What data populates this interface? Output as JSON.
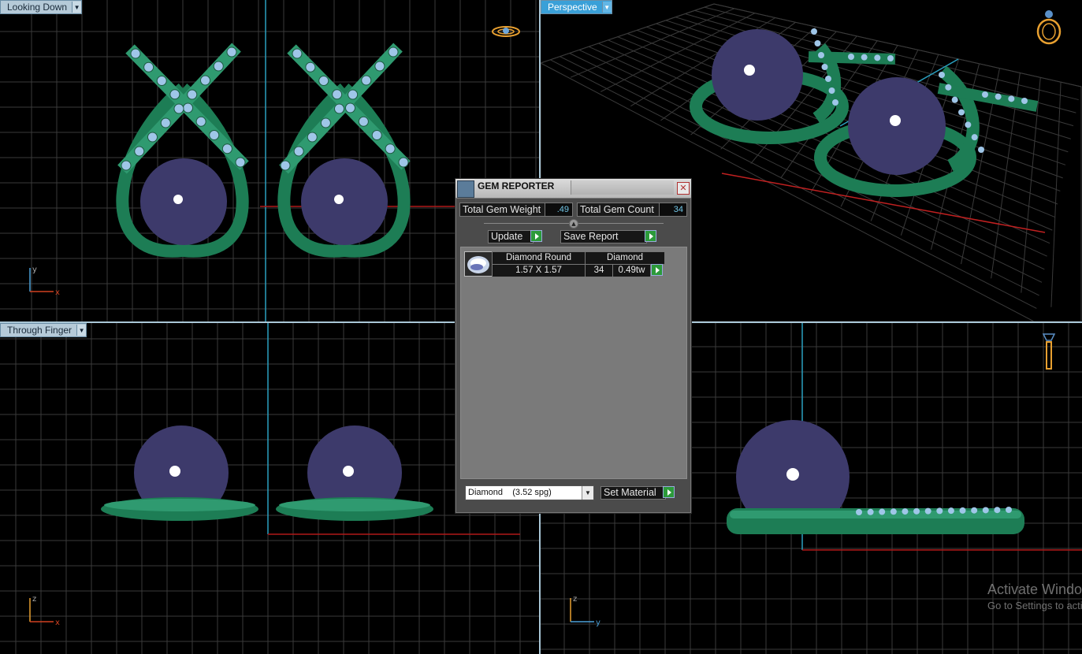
{
  "viewports": {
    "top_left": {
      "label": "Looking Down"
    },
    "top_right": {
      "label": "Perspective"
    },
    "bottom_left": {
      "label": "Through Finger"
    },
    "bottom_right": {
      "label": ""
    }
  },
  "axes": {
    "top_left": {
      "vertical": "y",
      "horizontal": "x"
    },
    "bottom_left": {
      "vertical": "z",
      "horizontal": "x"
    },
    "bottom_right": {
      "vertical": "z",
      "horizontal": "y"
    }
  },
  "colors": {
    "background": "#000000",
    "grid": "#3a3a3a",
    "axis_blue": "#2aa0c0",
    "axis_red": "#c02020",
    "metal_green": "#1d7d55",
    "pearl": "#3d3a6b",
    "gem": "#9fc6e8",
    "dialog_bg": "#4b4b4b",
    "value_cyan": "#72c7e8",
    "play_green": "#2c9a3a"
  },
  "dialog": {
    "title": "GEM REPORTER",
    "icon": "gem-reporter-icon",
    "total_gem_weight_label": "Total Gem Weight",
    "total_gem_weight_value": ".49",
    "total_gem_count_label": "Total Gem Count",
    "total_gem_count_value": "34",
    "update_label": "Update",
    "save_report_label": "Save Report",
    "gem_row": {
      "shape": "Diamond Round",
      "material": "Diamond",
      "size": "1.57 X 1.57",
      "count": "34",
      "weight": "0.49tw"
    },
    "material_select": "Diamond    (3.52 spg)",
    "set_material_label": "Set Material"
  },
  "watermark": {
    "line1": "Activate Windows",
    "line2": "Go to Settings to activate Windows."
  }
}
